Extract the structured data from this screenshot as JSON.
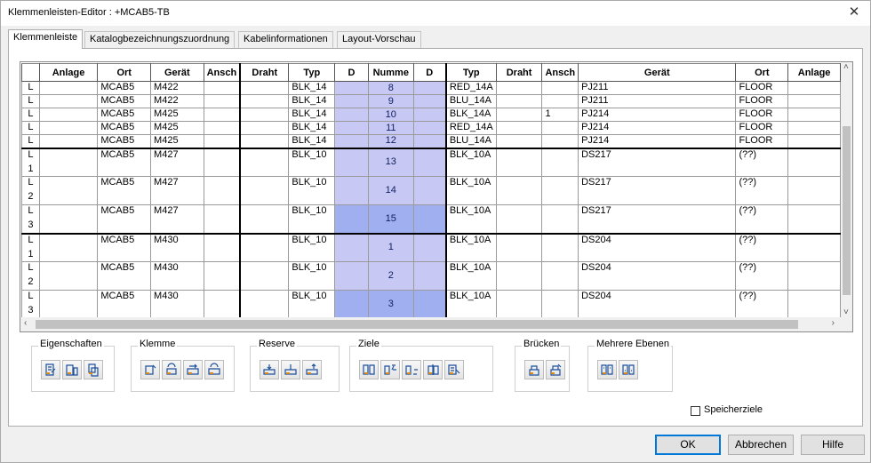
{
  "window": {
    "title": "Klemmenleisten-Editor : +MCAB5-TB",
    "close_label": "✕"
  },
  "tabs": [
    {
      "label": "Klemmenleiste"
    },
    {
      "label": "Katalogbezeichnungszuordnung"
    },
    {
      "label": "Kabelinformationen"
    },
    {
      "label": "Layout-Vorschau"
    }
  ],
  "columns": [
    "",
    "Anlage",
    "Ort",
    "Gerät",
    "Ansch",
    "Draht",
    "Typ",
    "D",
    "Numme",
    "D",
    "Typ",
    "Draht",
    "Ansch",
    "Gerät",
    "Ort",
    "Anlage"
  ],
  "rows": [
    {
      "hdr": [
        "L",
        ""
      ],
      "ort": "MCAB5",
      "geraet": "M422",
      "typ": "BLK_14",
      "num": "8",
      "rtyp": "RED_14A",
      "ransch": "",
      "rgeraet": "PJ211",
      "rort": "FLOOR",
      "tall": false
    },
    {
      "hdr": [
        "L",
        ""
      ],
      "ort": "MCAB5",
      "geraet": "M422",
      "typ": "BLK_14",
      "num": "9",
      "rtyp": "BLU_14A",
      "ransch": "",
      "rgeraet": "PJ211",
      "rort": "FLOOR",
      "tall": false
    },
    {
      "hdr": [
        "L",
        ""
      ],
      "ort": "MCAB5",
      "geraet": "M425",
      "typ": "BLK_14",
      "num": "10",
      "rtyp": "BLK_14A",
      "ransch": "1",
      "rgeraet": "PJ214",
      "rort": "FLOOR",
      "tall": false
    },
    {
      "hdr": [
        "L",
        ""
      ],
      "ort": "MCAB5",
      "geraet": "M425",
      "typ": "BLK_14",
      "num": "11",
      "rtyp": "RED_14A",
      "ransch": "",
      "rgeraet": "PJ214",
      "rort": "FLOOR",
      "tall": false
    },
    {
      "hdr": [
        "L",
        ""
      ],
      "ort": "MCAB5",
      "geraet": "M425",
      "typ": "BLK_14",
      "num": "12",
      "rtyp": "BLU_14A",
      "ransch": "",
      "rgeraet": "PJ214",
      "rort": "FLOOR",
      "tall": false
    },
    {
      "hdr": [
        "L",
        "1"
      ],
      "ort": "MCAB5",
      "geraet": "M427",
      "typ": "BLK_10",
      "num": "13",
      "rtyp": "BLK_10A",
      "ransch": "",
      "rgeraet": "DS217",
      "rort": "(??)",
      "tall": true
    },
    {
      "hdr": [
        "L",
        "2"
      ],
      "ort": "MCAB5",
      "geraet": "M427",
      "typ": "BLK_10",
      "num": "14",
      "rtyp": "BLK_10A",
      "ransch": "",
      "rgeraet": "DS217",
      "rort": "(??)",
      "tall": true
    },
    {
      "hdr": [
        "L",
        "3"
      ],
      "ort": "MCAB5",
      "geraet": "M427",
      "typ": "BLK_10",
      "num": "15",
      "rtyp": "BLK_10A",
      "ransch": "",
      "rgeraet": "DS217",
      "rort": "(??)",
      "tall": true
    },
    {
      "hdr": [
        "L",
        "1"
      ],
      "ort": "MCAB5",
      "geraet": "M430",
      "typ": "BLK_10",
      "num": "1",
      "rtyp": "BLK_10A",
      "ransch": "",
      "rgeraet": "DS204",
      "rort": "(??)",
      "tall": true
    },
    {
      "hdr": [
        "L",
        "2"
      ],
      "ort": "MCAB5",
      "geraet": "M430",
      "typ": "BLK_10",
      "num": "2",
      "rtyp": "BLK_10A",
      "ransch": "",
      "rgeraet": "DS204",
      "rort": "(??)",
      "tall": true
    },
    {
      "hdr": [
        "L",
        "3"
      ],
      "ort": "MCAB5",
      "geraet": "M430",
      "typ": "BLK_10",
      "num": "3",
      "rtyp": "BLK_10A",
      "ransch": "",
      "rgeraet": "DS204",
      "rort": "(??)",
      "tall": true
    }
  ],
  "groups": [
    {
      "label": "Eigenschaften",
      "icons": [
        "edit-properties-icon",
        "catalog-properties-icon",
        "copy-properties-icon"
      ]
    },
    {
      "label": "Klemme",
      "icons": [
        "move-terminal-icon",
        "rotate-terminal-icon",
        "renumber-terminal-icon",
        "insert-terminal-icon"
      ]
    },
    {
      "label": "Reserve",
      "icons": [
        "insert-spare-icon",
        "spare-terminal-icon",
        "delete-spare-icon"
      ]
    },
    {
      "label": "Ziele",
      "icons": [
        "swap-destinations-icon",
        "move-destination-up-icon",
        "move-destination-down-icon",
        "flip-destinations-icon",
        "edit-destinations-icon"
      ]
    },
    {
      "label": "Brücken",
      "icons": [
        "jumper-icon",
        "edit-jumper-icon"
      ]
    },
    {
      "label": "Mehrere Ebenen",
      "icons": [
        "multi-level-icon",
        "multi-level-edit-icon"
      ]
    }
  ],
  "checkbox": {
    "label": "Speicherziele",
    "checked": false
  },
  "buttons": {
    "ok": "OK",
    "cancel": "Abbrechen",
    "help": "Hilfe"
  },
  "colors": {
    "d_column": "#c8c8f4",
    "d_selected": "#a0aff0",
    "ok_border": "#0078d7"
  }
}
